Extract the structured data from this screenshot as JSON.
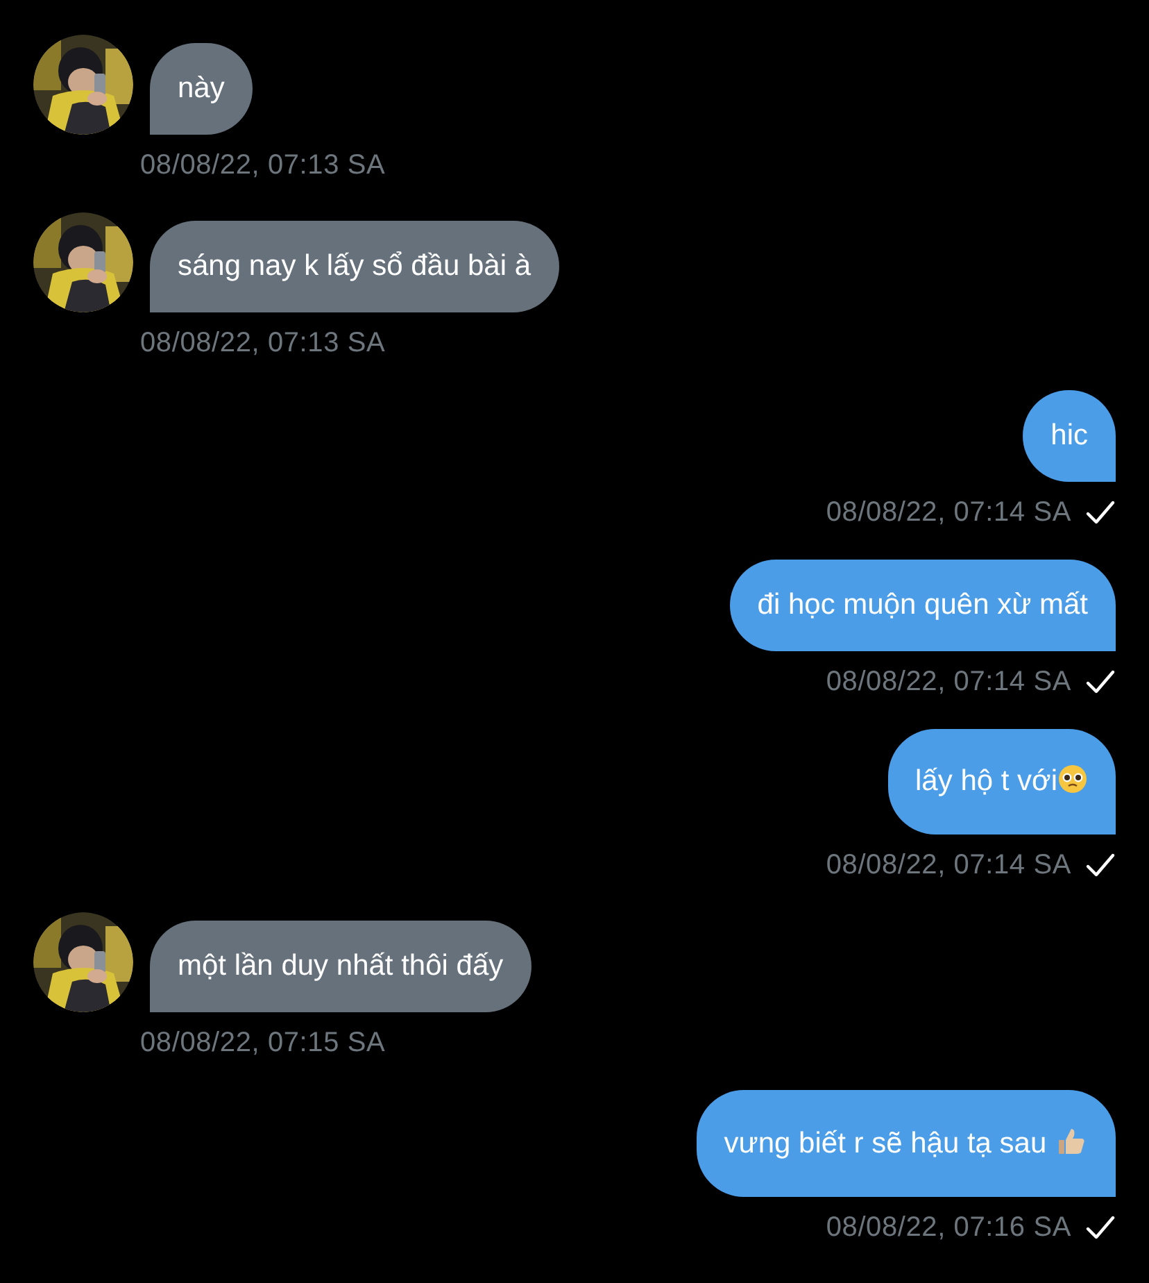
{
  "messages": [
    {
      "kind": "incoming",
      "text": "này",
      "time": "08/08/22, 07:13 SA",
      "seen": false
    },
    {
      "kind": "incoming",
      "text": "sáng nay k lấy sổ đầu bài à",
      "time": "08/08/22, 07:13 SA",
      "seen": false
    },
    {
      "kind": "outgoing",
      "text": "hic",
      "time": "08/08/22, 07:14 SA",
      "seen": true
    },
    {
      "kind": "outgoing",
      "text": "đi học muộn quên xừ mất",
      "time": "08/08/22, 07:14 SA",
      "seen": true
    },
    {
      "kind": "outgoing",
      "text": "lấy hộ t với",
      "emoji": {
        "kind": "pleading"
      },
      "time": "08/08/22, 07:14 SA",
      "seen": true
    },
    {
      "kind": "incoming",
      "text": "một lần duy nhất thôi đấy",
      "time": "08/08/22, 07:15 SA",
      "seen": false
    },
    {
      "kind": "outgoing",
      "text": "vưng biết r sẽ hậu tạ sau ",
      "emoji": {
        "kind": "thumbs_up"
      },
      "time": "08/08/22, 07:16 SA",
      "seen": true
    }
  ]
}
